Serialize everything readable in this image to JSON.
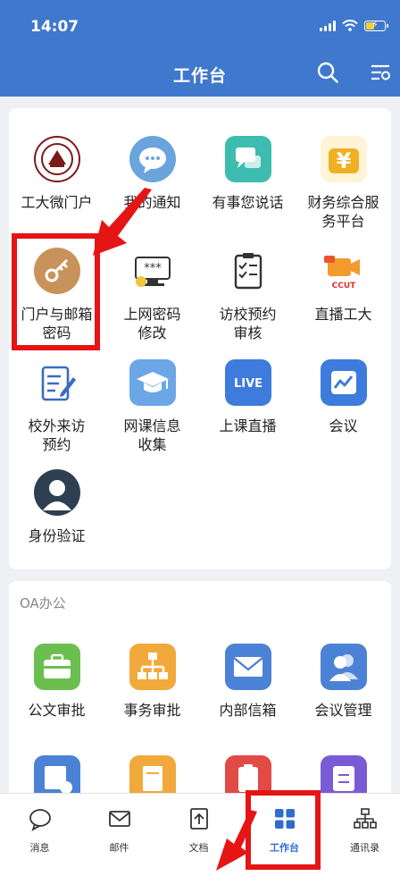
{
  "status_bar": {
    "time": "14:07"
  },
  "header": {
    "title": "工作台"
  },
  "apps": [
    {
      "label": "工大微门户",
      "icon": "university-seal-icon"
    },
    {
      "label": "我的通知",
      "icon": "chat-bubble-icon"
    },
    {
      "label": "有事您说话",
      "icon": "speech-bubbles-icon"
    },
    {
      "label": "财务综合服\n务平台",
      "icon": "yuan-wallet-icon"
    },
    {
      "label": "门户与邮箱\n密码",
      "icon": "key-icon"
    },
    {
      "label": "上网密码\n修改",
      "icon": "password-monitor-icon"
    },
    {
      "label": "访校预约\n审核",
      "icon": "clipboard-check-icon"
    },
    {
      "label": "直播工大",
      "icon": "live-camera-icon"
    },
    {
      "label": "校外来访\n预约",
      "icon": "edit-form-icon"
    },
    {
      "label": "网课信息\n收集",
      "icon": "graduation-cap-icon"
    },
    {
      "label": "上课直播",
      "icon": "live-badge-icon"
    },
    {
      "label": "会议",
      "icon": "meeting-chart-icon"
    },
    {
      "label": "身份验证",
      "icon": "user-avatar-icon"
    }
  ],
  "oa_section": {
    "title": "OA办公",
    "apps": [
      {
        "label": "公文审批",
        "icon": "briefcase-icon"
      },
      {
        "label": "事务审批",
        "icon": "org-chart-icon"
      },
      {
        "label": "内部信箱",
        "icon": "envelope-icon"
      },
      {
        "label": "会议管理",
        "icon": "users-icon"
      }
    ],
    "partial_icons": [
      "document-check-icon",
      "invoice-icon",
      "clipboard-red-icon",
      "exchange-icon"
    ]
  },
  "icon_live_text": "LIVE",
  "icon_ccut_text": "CCUT",
  "bottom_nav": {
    "items": [
      {
        "label": "消息",
        "icon": "message-icon"
      },
      {
        "label": "邮件",
        "icon": "mail-icon"
      },
      {
        "label": "文档",
        "icon": "folder-doc-icon"
      },
      {
        "label": "工作台",
        "icon": "grid-icon",
        "active": true
      },
      {
        "label": "通讯录",
        "icon": "org-tree-icon"
      }
    ]
  },
  "colors": {
    "header": "#3f78cc",
    "highlight": "#e61515",
    "active_nav": "#2f6bd0"
  }
}
